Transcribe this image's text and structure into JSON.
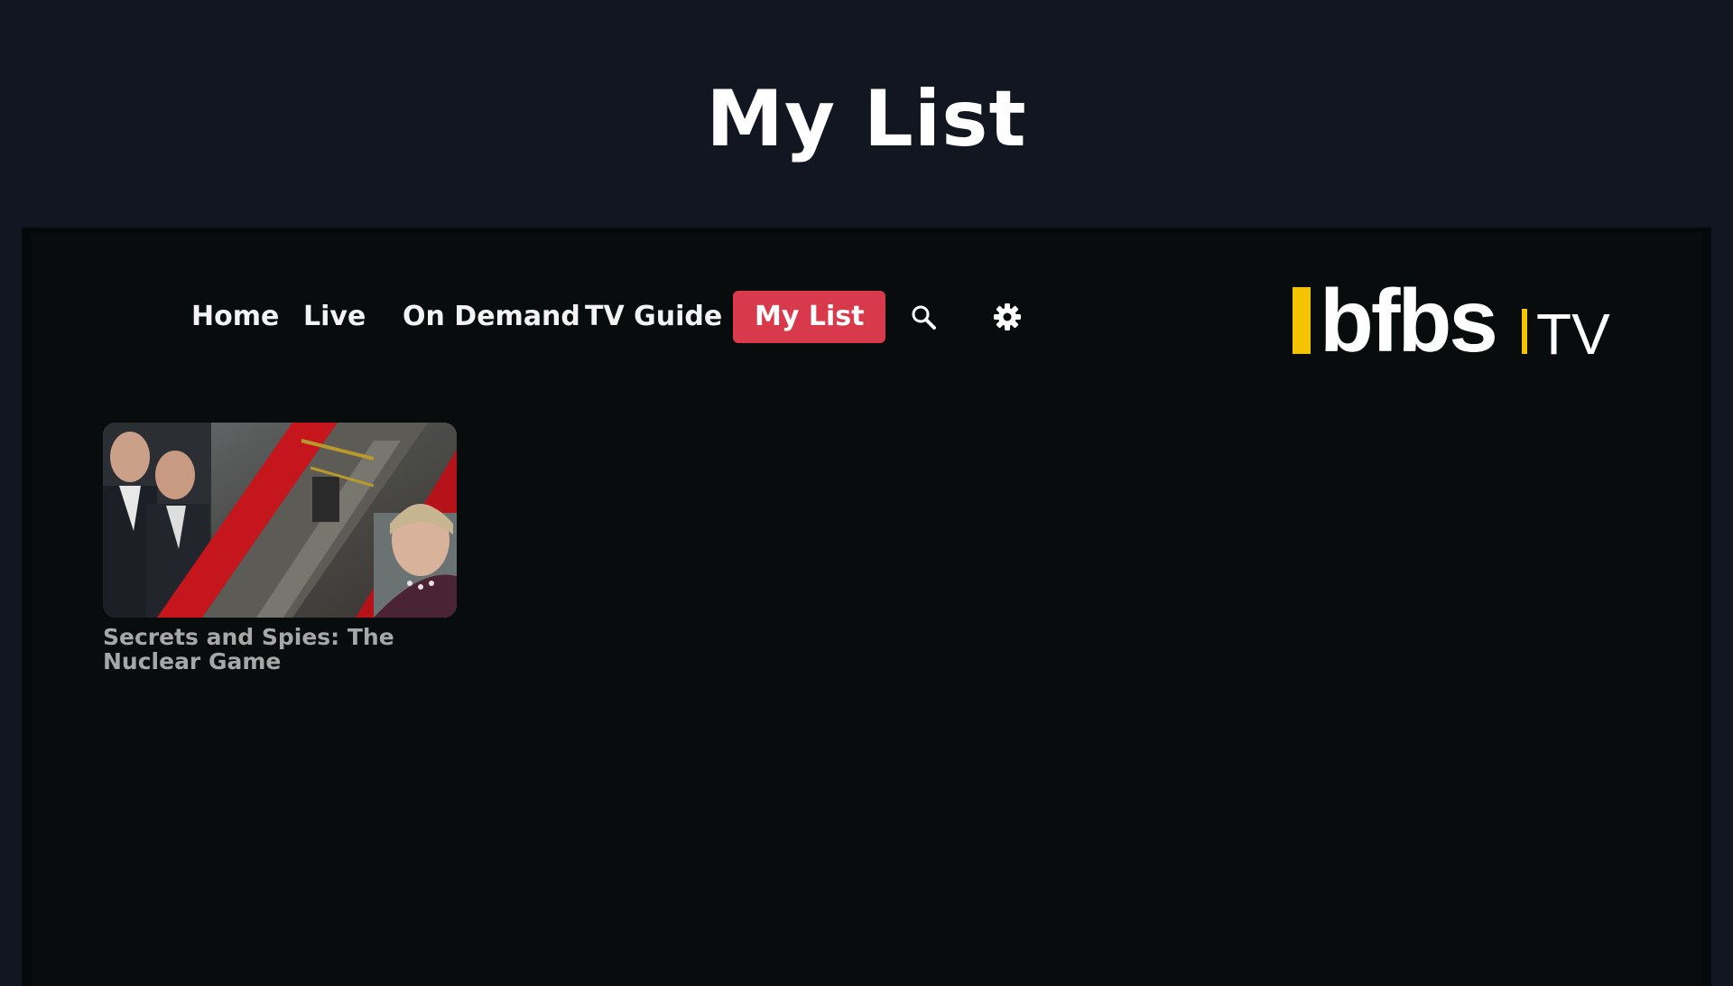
{
  "page": {
    "title": "My List"
  },
  "nav": {
    "items": [
      {
        "label": "Home",
        "active": false
      },
      {
        "label": "Live",
        "active": false
      },
      {
        "label": "On Demand",
        "active": false
      },
      {
        "label": "TV Guide",
        "active": false
      },
      {
        "label": "My List",
        "active": true
      }
    ],
    "icons": [
      "search-icon",
      "gear-icon"
    ]
  },
  "brand": {
    "name": "bfbs",
    "suffix": "TV",
    "accent_color": "#f5c400",
    "active_color": "#d93a4b"
  },
  "my_list": {
    "items": [
      {
        "title": "Secrets and Spies: The Nuclear Game"
      }
    ]
  }
}
